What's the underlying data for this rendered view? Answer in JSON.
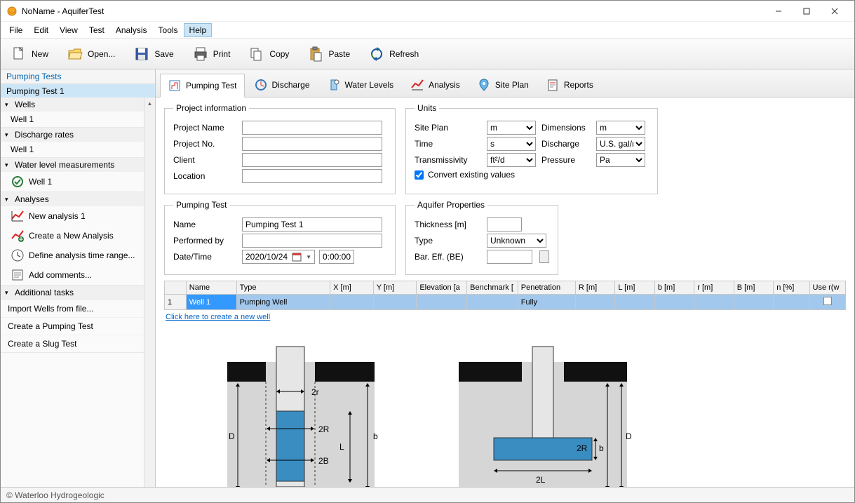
{
  "window": {
    "title": "NoName - AquiferTest"
  },
  "menu": {
    "file": "File",
    "edit": "Edit",
    "view": "View",
    "test": "Test",
    "analysis": "Analysis",
    "tools": "Tools",
    "help": "Help"
  },
  "toolbar": {
    "new": "New",
    "open": "Open...",
    "save": "Save",
    "print": "Print",
    "copy": "Copy",
    "paste": "Paste",
    "refresh": "Refresh"
  },
  "left": {
    "tests_header": "Pumping Tests",
    "test1": "Pumping Test 1",
    "groups": {
      "wells": "Wells",
      "wells_child": "Well 1",
      "discharge": "Discharge rates",
      "discharge_child": "Well 1",
      "wlm": "Water level measurements",
      "wlm_child": "Well 1",
      "analyses": "Analyses",
      "analyses_children": {
        "new": "New analysis 1",
        "create": "Create a New Analysis",
        "timerange": "Define analysis time range...",
        "comments": "Add comments..."
      },
      "addtasks": "Additional tasks",
      "addtasks_children": {
        "import": "Import Wells from file...",
        "pump": "Create a Pumping Test",
        "slug": "Create a Slug Test"
      }
    }
  },
  "tabs": {
    "pumping": "Pumping Test",
    "discharge": "Discharge",
    "waterlevels": "Water Levels",
    "analysis": "Analysis",
    "siteplan": "Site Plan",
    "reports": "Reports"
  },
  "project": {
    "legend": "Project information",
    "name_label": "Project Name",
    "name_value": "",
    "no_label": "Project No.",
    "no_value": "",
    "client_label": "Client",
    "client_value": "",
    "location_label": "Location",
    "location_value": ""
  },
  "units": {
    "legend": "Units",
    "siteplan_label": "Site Plan",
    "siteplan_value": "m",
    "dimensions_label": "Dimensions",
    "dimensions_value": "m",
    "time_label": "Time",
    "time_value": "s",
    "discharge_label": "Discharge",
    "discharge_value": "U.S. gal/min",
    "trans_label": "Transmissivity",
    "trans_value": "ft²/d",
    "pressure_label": "Pressure",
    "pressure_value": "Pa",
    "convert": "Convert existing values"
  },
  "pumping": {
    "legend": "Pumping Test",
    "name_label": "Name",
    "name_value": "Pumping Test 1",
    "performed_label": "Performed by",
    "performed_value": "",
    "datetime_label": "Date/Time",
    "date_value": "2020/10/24",
    "time_value": "0:00:00"
  },
  "aquifer": {
    "legend": "Aquifer Properties",
    "thickness_label": "Thickness [m]",
    "thickness_value": "",
    "type_label": "Type",
    "type_value": "Unknown",
    "bareff_label": "Bar. Eff. (BE)",
    "bareff_value": ""
  },
  "wells_table": {
    "headers": {
      "rownum": "",
      "name": "Name",
      "type": "Type",
      "x": "X [m]",
      "y": "Y [m]",
      "elev": "Elevation [a",
      "bench": "Benchmark [",
      "penet": "Penetration",
      "R": "R [m]",
      "L": "L [m]",
      "b": "b [m]",
      "r": "r [m]",
      "B": "B [m]",
      "n": "n [%]",
      "use": "Use r(w"
    },
    "row": {
      "num": "1",
      "name": "Well 1",
      "type": "Pumping Well",
      "penet": "Fully"
    },
    "new_link": "Click here to create a new well"
  },
  "diagram_labels": {
    "D": "D",
    "r2": "2r",
    "b": "b",
    "R2": "2R",
    "L": "L",
    "B2": "2B",
    "L2": "2L"
  },
  "status": "© Waterloo Hydrogeologic"
}
